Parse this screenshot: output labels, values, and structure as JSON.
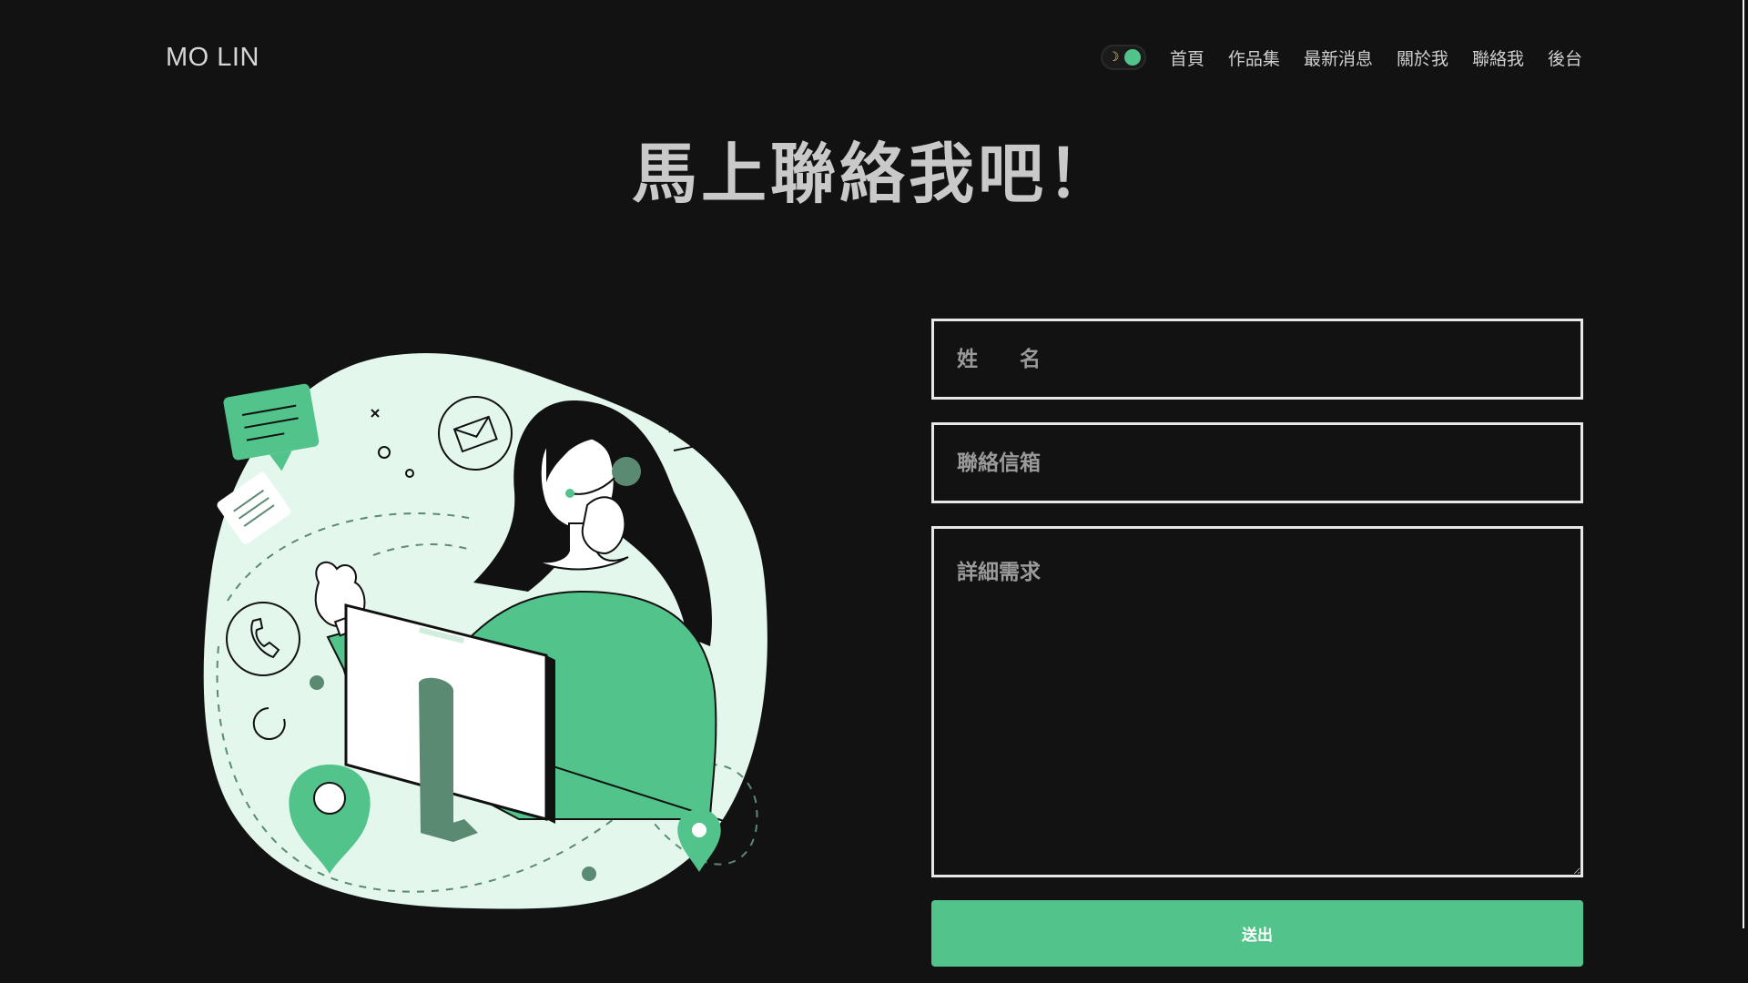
{
  "brand": {
    "name": "MO LIN"
  },
  "nav": {
    "items": [
      {
        "label": "首頁"
      },
      {
        "label": "作品集"
      },
      {
        "label": "最新消息"
      },
      {
        "label": "關於我"
      },
      {
        "label": "聯絡我"
      },
      {
        "label": "後台"
      }
    ],
    "theme_toggle": {
      "icon": "moon-icon",
      "state": "dark"
    }
  },
  "page": {
    "title": "馬上聯絡我吧！"
  },
  "form": {
    "name_placeholder": "姓　　名",
    "email_placeholder": "聯絡信箱",
    "message_placeholder": "詳細需求",
    "submit_label": "送出"
  },
  "colors": {
    "background": "#121212",
    "accent": "#52c38a",
    "accent_dark": "#5b8a72",
    "blob": "#e3f7ec",
    "text": "#cfcfcf",
    "border": "#e8e8e8"
  }
}
